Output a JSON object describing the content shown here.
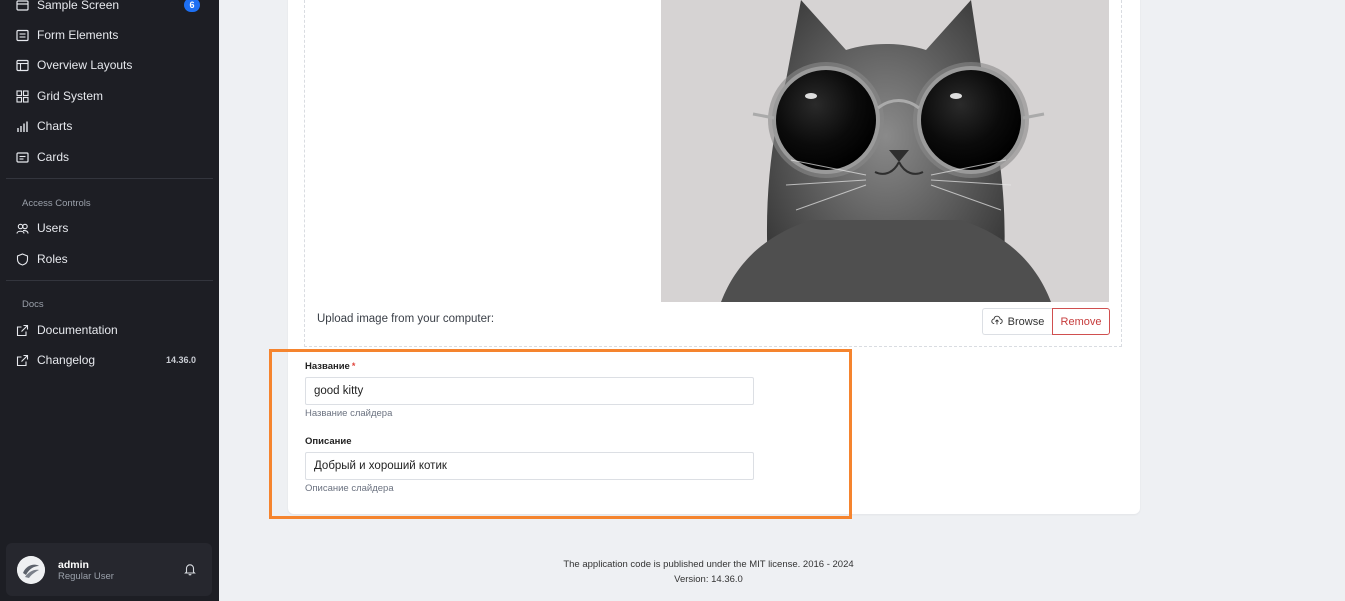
{
  "sidebar": {
    "items": [
      {
        "label": "Sample Screen",
        "icon": "window-icon",
        "badge": "6"
      },
      {
        "label": "Form Elements",
        "icon": "list-icon"
      },
      {
        "label": "Overview Layouts",
        "icon": "layout-icon"
      },
      {
        "label": "Grid System",
        "icon": "grid-icon"
      },
      {
        "label": "Charts",
        "icon": "chart-icon"
      },
      {
        "label": "Cards",
        "icon": "card-icon"
      }
    ],
    "access_section": "Access Controls",
    "access_items": [
      {
        "label": "Users",
        "icon": "users-icon"
      },
      {
        "label": "Roles",
        "icon": "shield-icon"
      }
    ],
    "docs_section": "Docs",
    "docs_items": [
      {
        "label": "Documentation",
        "icon": "external-link-icon"
      },
      {
        "label": "Changelog",
        "icon": "external-link-icon",
        "tag": "14.36.0"
      }
    ],
    "user": {
      "name": "admin",
      "role": "Regular User"
    }
  },
  "upload": {
    "label": "Upload image from your computer:",
    "browse_label": "Browse",
    "remove_label": "Remove"
  },
  "form": {
    "title_label": "Название",
    "title_required": "*",
    "title_value": "good kitty",
    "title_help": "Название слайдера",
    "desc_label": "Описание",
    "desc_value": "Добрый и хороший котик",
    "desc_help": "Описание слайдера"
  },
  "footer": {
    "license": "The application code is published under the MIT license. 2016 - 2024",
    "version": "Version: 14.36.0"
  },
  "colors": {
    "sidebar_bg": "#1d1e24",
    "badge": "#1d6ff2",
    "highlight": "#f5842e",
    "remove": "#c63b3b"
  }
}
